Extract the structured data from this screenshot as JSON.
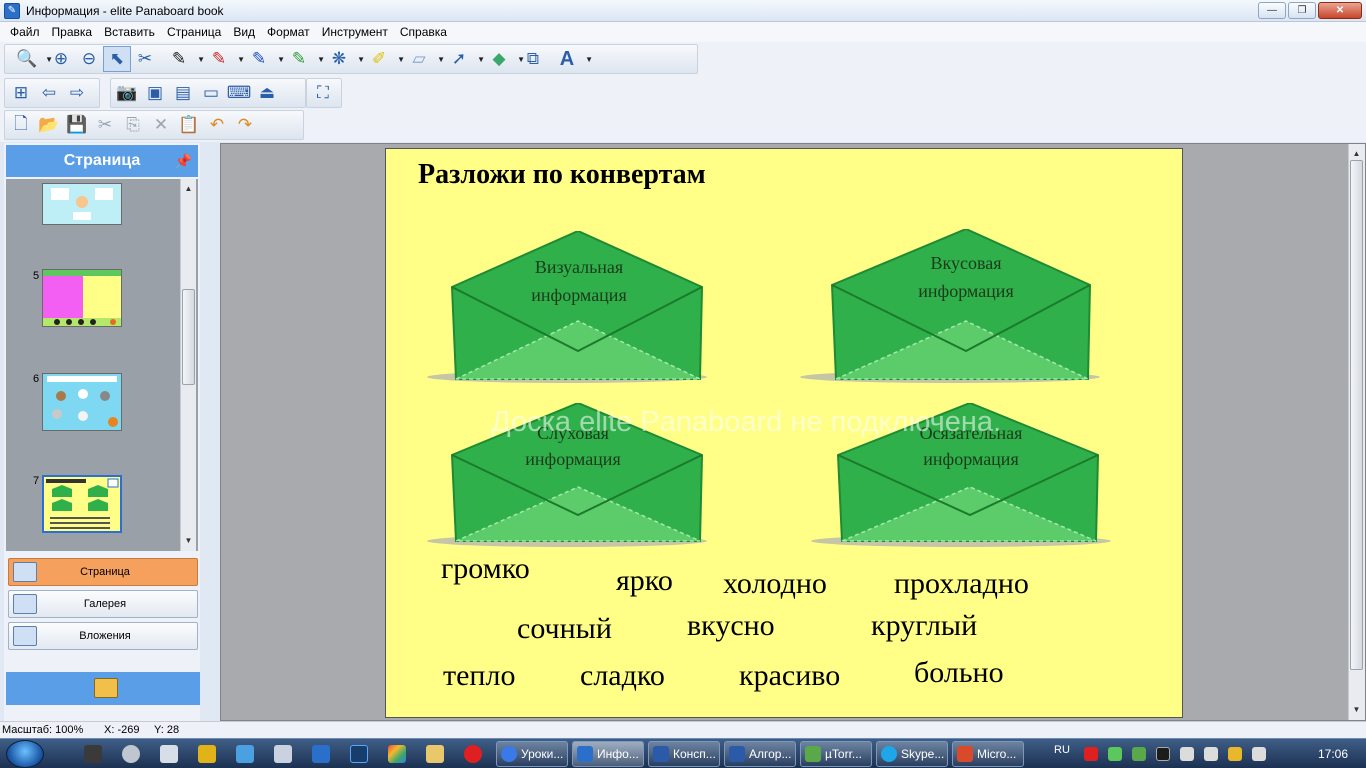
{
  "window": {
    "title": "Информация - elite Panaboard book",
    "min": "—",
    "max": "❐",
    "close": "✕"
  },
  "menu": [
    "Файл",
    "Правка",
    "Вставить",
    "Страница",
    "Вид",
    "Формат",
    "Инструмент",
    "Справка"
  ],
  "panel": {
    "title": "Страница",
    "pages": [
      {
        "num": "5"
      },
      {
        "num": "6"
      },
      {
        "num": "7"
      }
    ],
    "tabs": [
      {
        "label": "Страница",
        "active": true
      },
      {
        "label": "Галерея",
        "active": false
      },
      {
        "label": "Вложения",
        "active": false
      }
    ]
  },
  "canvas": {
    "heading": "Разложи по конвертам",
    "envelopes": [
      {
        "line1": "Визуальная",
        "line2": "информация"
      },
      {
        "line1": "Вкусовая",
        "line2": "информация"
      },
      {
        "line1": "Слуховая",
        "line2": "информация"
      },
      {
        "line1": "Осязательная",
        "line2": "информация"
      }
    ],
    "words": [
      "громко",
      "ярко",
      "холодно",
      "прохладно",
      "сочный",
      "вкусно",
      "круглый",
      "тепло",
      "сладко",
      "красиво",
      "больно"
    ],
    "overlay": "Доска elite Panaboard не подключена."
  },
  "status": {
    "scale": "Масштаб: 100%",
    "x": "X: -269",
    "y": "Y: 28"
  },
  "taskbar": {
    "lang": "RU",
    "clock": "17:06",
    "buttons": [
      "Уроки...",
      "Инфо...",
      "Консп...",
      "Алгор...",
      "µTorr...",
      "Skype...",
      "Micro..."
    ]
  },
  "colors": {
    "accent": "#5b9ee8",
    "canvas_bg": "#ffff88",
    "envelope": "#2fb04a",
    "active_tab": "#f5a05c"
  }
}
